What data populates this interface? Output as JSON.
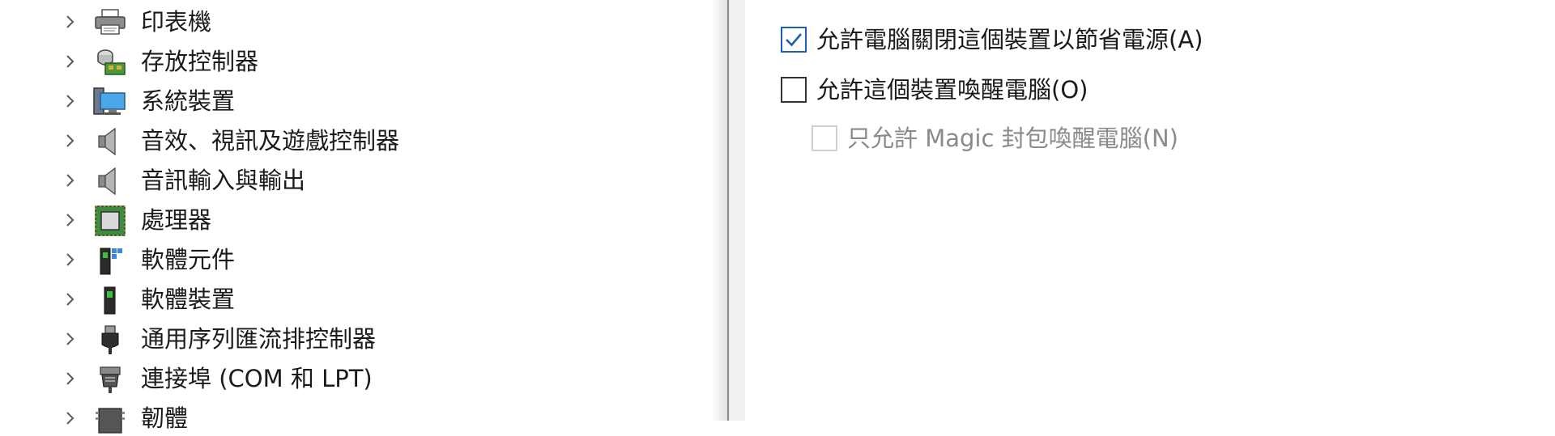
{
  "device_tree": {
    "items": [
      {
        "label": "印表機",
        "icon": "printer-icon"
      },
      {
        "label": "存放控制器",
        "icon": "storage-controller-icon"
      },
      {
        "label": "系統裝置",
        "icon": "system-device-icon"
      },
      {
        "label": "音效、視訊及遊戲控制器",
        "icon": "speaker-icon"
      },
      {
        "label": "音訊輸入與輸出",
        "icon": "speaker-icon"
      },
      {
        "label": "處理器",
        "icon": "processor-icon"
      },
      {
        "label": "軟體元件",
        "icon": "software-component-icon"
      },
      {
        "label": "軟體裝置",
        "icon": "software-device-icon"
      },
      {
        "label": "通用序列匯流排控制器",
        "icon": "usb-icon"
      },
      {
        "label": "連接埠 (COM 和 LPT)",
        "icon": "port-icon"
      },
      {
        "label": "韌體",
        "icon": "firmware-icon"
      }
    ]
  },
  "power_management": {
    "allow_turn_off": {
      "label": "允許電腦關閉這個裝置以節省電源(A)",
      "checked": true
    },
    "allow_wake": {
      "label": "允許這個裝置喚醒電腦(O)",
      "checked": false
    },
    "magic_packet_only": {
      "label": "只允許 Magic 封包喚醒電腦(N)",
      "checked": false,
      "disabled": true
    }
  },
  "colors": {
    "checkbox_accent": "#1a5fb4",
    "disabled_text": "#8a8a8a"
  }
}
